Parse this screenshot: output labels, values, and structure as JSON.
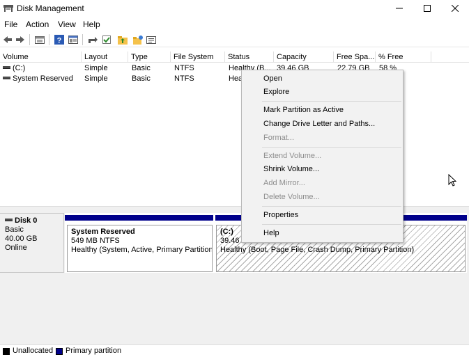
{
  "window": {
    "title": "Disk Management"
  },
  "menu": [
    "File",
    "Action",
    "View",
    "Help"
  ],
  "toolbar_icons": [
    "back-icon",
    "forward-icon",
    "disk-list-icon",
    "help-icon",
    "properties-icon",
    "rescan-icon",
    "check-icon",
    "folder-up-icon",
    "folder-new-icon",
    "view-icon"
  ],
  "table": {
    "columns": [
      "Volume",
      "Layout",
      "Type",
      "File System",
      "Status",
      "Capacity",
      "Free Spa...",
      "% Free"
    ],
    "rows": [
      [
        "(C:)",
        "Simple",
        "Basic",
        "NTFS",
        "Healthy (B...",
        "39.46 GB",
        "22.79 GB",
        "58 %"
      ],
      [
        "System Reserved",
        "Simple",
        "Basic",
        "NTFS",
        "Hea",
        "",
        "",
        ""
      ]
    ]
  },
  "disk": {
    "name": "Disk 0",
    "type": "Basic",
    "size": "40.00 GB",
    "status": "Online",
    "partitions": [
      {
        "name": "System Reserved",
        "detail": "549 MB NTFS",
        "status": "Healthy (System, Active, Primary Partition)"
      },
      {
        "name": "(C:)",
        "detail": "39.46 GB NTFS",
        "status": "Healthy (Boot, Page File, Crash Dump, Primary Partition)"
      }
    ]
  },
  "legend": {
    "unallocated": "Unallocated",
    "primary": "Primary partition"
  },
  "context_menu": [
    {
      "label": "Open",
      "enabled": true
    },
    {
      "label": "Explore",
      "enabled": true
    },
    {
      "label": "Mark Partition as Active",
      "enabled": true
    },
    {
      "label": "Change Drive Letter and Paths...",
      "enabled": true
    },
    {
      "label": "Format...",
      "enabled": false
    },
    {
      "label": "Extend Volume...",
      "enabled": false
    },
    {
      "label": "Shrink Volume...",
      "enabled": true
    },
    {
      "label": "Add Mirror...",
      "enabled": false
    },
    {
      "label": "Delete Volume...",
      "enabled": false
    },
    {
      "label": "Properties",
      "enabled": true
    },
    {
      "label": "Help",
      "enabled": true
    }
  ],
  "colors": {
    "primary_partition": "#00008b",
    "unallocated": "#000000"
  }
}
